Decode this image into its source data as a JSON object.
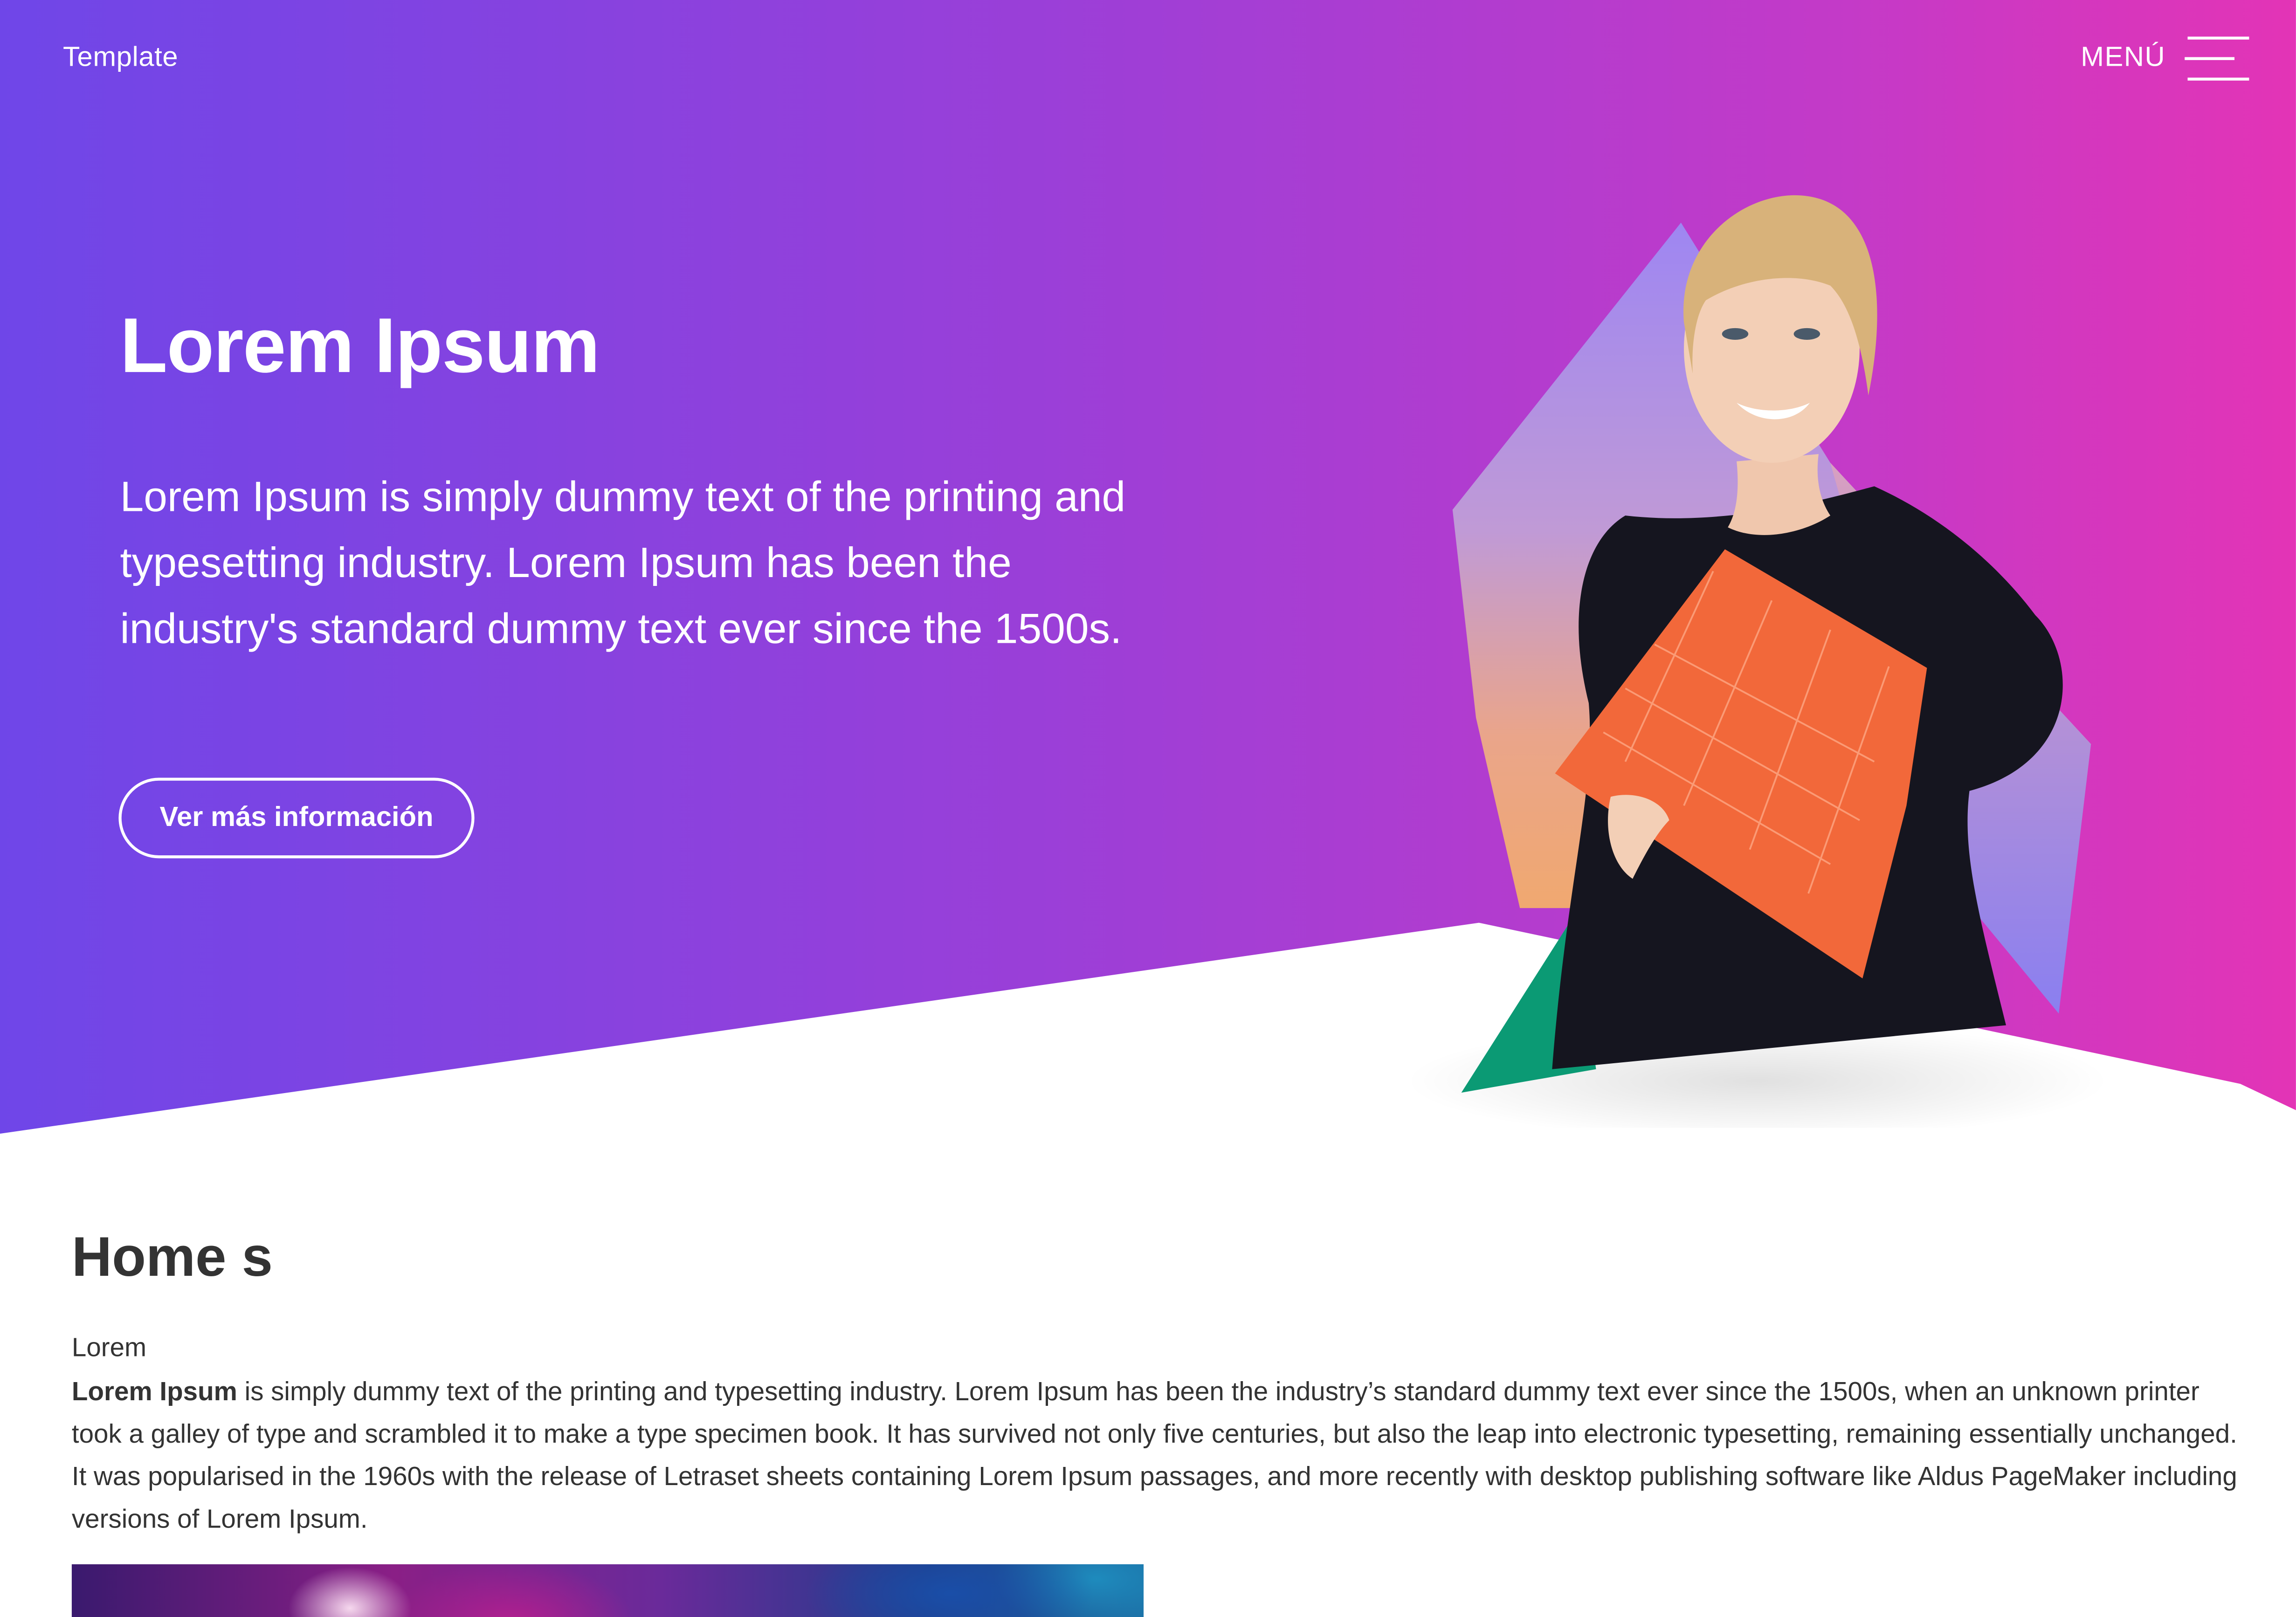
{
  "header": {
    "brand": "Template",
    "menu_label": "MENÚ"
  },
  "hero": {
    "title": "Lorem Ipsum",
    "text": "Lorem Ipsum is simply dummy text of the printing and typesetting industry. Lorem Ipsum has been the industry's standard dummy text ever since the 1500s.",
    "button_label": "Ver más información",
    "gradient_start": "#6f46e8",
    "gradient_end": "#e334b6"
  },
  "section": {
    "title": "Home s",
    "subtitle": "Lorem",
    "body_bold": "Lorem Ipsum",
    "body_rest": " is simply dummy text of the printing and typesetting industry. Lorem Ipsum has been the industry’s standard dummy text ever since the 1500s, when an unknown printer took a galley of type and scrambled it to make a type specimen book. It has survived not only five centuries, but also the leap into electronic typesetting, remaining essentially unchanged. It was popularised in the 1960s with the release of Letraset sheets containing Lorem Ipsum passages, and more recently with desktop publishing software like Aldus PageMaker including versions of Lorem Ipsum."
  },
  "icons": {
    "menu": "hamburger-icon"
  }
}
